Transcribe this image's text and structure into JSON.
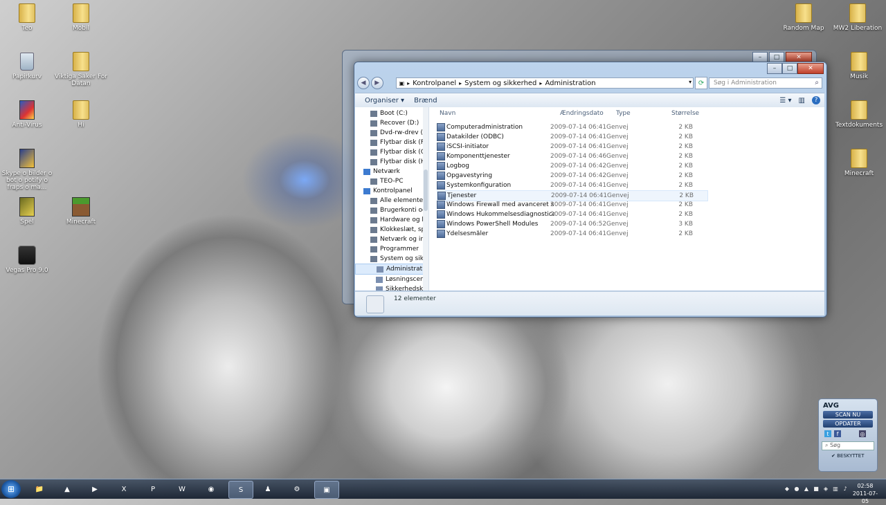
{
  "desktop": {
    "icons": [
      {
        "label": "Teo",
        "type": "folder"
      },
      {
        "label": "Mobil",
        "type": "folder"
      },
      {
        "label": "Papirkurv",
        "type": "recycle-bin"
      },
      {
        "label": "Viktiga Saker For Datan",
        "type": "folder"
      },
      {
        "label": "Anti-Virus",
        "type": "app"
      },
      {
        "label": "Hi",
        "type": "folder"
      },
      {
        "label": "Skype o bilder o bot o potify o fraps o ma...",
        "type": "app"
      },
      {
        "label": "Spel",
        "type": "app"
      },
      {
        "label": "Minecraft",
        "type": "app"
      },
      {
        "label": "Vegas Pro 9.0",
        "type": "app"
      },
      {
        "label": "Random Map",
        "type": "folder"
      },
      {
        "label": "MW2 Liberation",
        "type": "folder"
      },
      {
        "label": "Musik",
        "type": "folder"
      },
      {
        "label": "Textdokuments",
        "type": "folder"
      },
      {
        "label": "Minecraft",
        "type": "folder"
      }
    ]
  },
  "explorer": {
    "breadcrumb": [
      "Kontrolpanel",
      "System og sikkerhed",
      "Administration"
    ],
    "search_placeholder": "Søg i Administration",
    "toolbar": {
      "organize": "Organiser",
      "burn": "Brænd"
    },
    "nav_items": [
      {
        "label": "Boot (C:)",
        "indent": 1
      },
      {
        "label": "Recover (D:)",
        "indent": 1
      },
      {
        "label": "Dvd-rw-drev (E",
        "indent": 1
      },
      {
        "label": "Flytbar disk (F:)",
        "indent": 1
      },
      {
        "label": "Flytbar disk (G:",
        "indent": 1
      },
      {
        "label": "Flytbar disk (H:",
        "indent": 1
      },
      {
        "label": "Netværk",
        "indent": 0
      },
      {
        "label": "TEO-PC",
        "indent": 1
      },
      {
        "label": "Kontrolpanel",
        "indent": 0
      },
      {
        "label": "Alle elementer",
        "indent": 1
      },
      {
        "label": "Brugerkonti og",
        "indent": 1
      },
      {
        "label": "Hardware og ly",
        "indent": 1
      },
      {
        "label": "Klokkeslæt, spr",
        "indent": 1
      },
      {
        "label": "Netværk og int",
        "indent": 1
      },
      {
        "label": "Programmer",
        "indent": 1
      },
      {
        "label": "System og sikk",
        "indent": 1
      },
      {
        "label": "Administratic",
        "indent": 2,
        "selected": true
      },
      {
        "label": "Løsningscent",
        "indent": 2
      },
      {
        "label": "Sikkerhedsko",
        "indent": 2
      }
    ],
    "columns": {
      "name": "Navn",
      "date": "Ændringsdato",
      "type": "Type",
      "size": "Størrelse"
    },
    "files": [
      {
        "name": "Computeradministration",
        "date": "2009-07-14 06:41",
        "type": "Genvej",
        "size": "2 KB"
      },
      {
        "name": "Datakilder (ODBC)",
        "date": "2009-07-14 06:41",
        "type": "Genvej",
        "size": "2 KB"
      },
      {
        "name": "iSCSI-initiator",
        "date": "2009-07-14 06:41",
        "type": "Genvej",
        "size": "2 KB"
      },
      {
        "name": "Komponenttjenester",
        "date": "2009-07-14 06:46",
        "type": "Genvej",
        "size": "2 KB"
      },
      {
        "name": "Logbog",
        "date": "2009-07-14 06:42",
        "type": "Genvej",
        "size": "2 KB"
      },
      {
        "name": "Opgavestyring",
        "date": "2009-07-14 06:42",
        "type": "Genvej",
        "size": "2 KB"
      },
      {
        "name": "Systemkonfiguration",
        "date": "2009-07-14 06:41",
        "type": "Genvej",
        "size": "2 KB"
      },
      {
        "name": "Tjenester",
        "date": "2009-07-14 06:41",
        "type": "Genvej",
        "size": "2 KB",
        "hover": true
      },
      {
        "name": "Windows Firewall med avanceret sikkerh...",
        "date": "2009-07-14 06:41",
        "type": "Genvej",
        "size": "2 KB"
      },
      {
        "name": "Windows Hukommelsesdiagnosticering",
        "date": "2009-07-14 06:41",
        "type": "Genvej",
        "size": "2 KB"
      },
      {
        "name": "Windows PowerShell Modules",
        "date": "2009-07-14 06:52",
        "type": "Genvej",
        "size": "3 KB"
      },
      {
        "name": "Ydelsesmåler",
        "date": "2009-07-14 06:41",
        "type": "Genvej",
        "size": "2 KB"
      }
    ],
    "item_count": "12 elementer"
  },
  "avg": {
    "title": "AVG",
    "scan": "SCAN NU",
    "update": "OPDATER",
    "search": "Søg",
    "status": "BESKYTTET"
  },
  "taskbar": {
    "time": "02:58",
    "date": "2011-07-05"
  }
}
